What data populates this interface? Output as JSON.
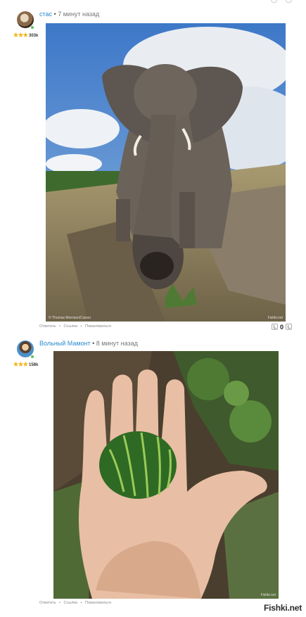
{
  "comments": [
    {
      "username": "стас",
      "separator": "•",
      "time": "7 минут назад",
      "rating": "303k",
      "stars": "★★★",
      "actions": [
        "Ответить",
        "•",
        "Ссылка",
        "•",
        "Пожаловаться"
      ],
      "watermark_left": "© Thomas Morrison/Canon",
      "watermark_right": "Fishki.net",
      "vote_count": "0"
    },
    {
      "username": "Вольный Мамонт",
      "separator": "•",
      "time": "8 минут назад",
      "rating": "158k",
      "stars": "★★★",
      "actions": [
        "Ответить",
        "•",
        "Ссылка",
        "•",
        "Пожаловаться"
      ],
      "watermark_right": "Fishki.net"
    }
  ],
  "site_logo": "Fishki.net",
  "colors": {
    "username": "#2a8ad0",
    "stars": "#f2b51c",
    "online": "#5cc15c"
  },
  "icons": {
    "vote": "thumb-icon",
    "top": "arrow-icon"
  }
}
